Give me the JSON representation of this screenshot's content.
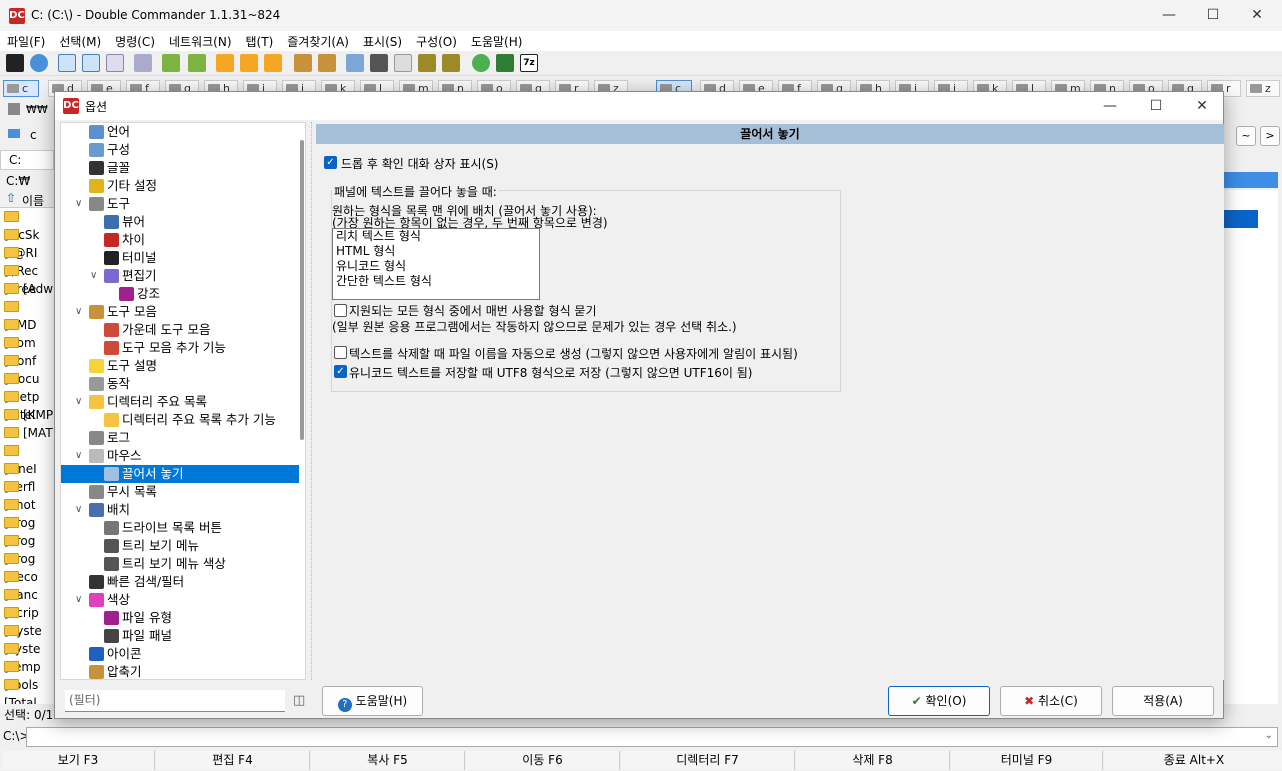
{
  "window": {
    "title": "C: (C:\\) - Double Commander 1.1.31~824",
    "logo": "DC"
  },
  "menu": [
    "파일(F)",
    "선택(M)",
    "명령(C)",
    "네트워크(N)",
    "탭(T)",
    "즐겨찾기(A)",
    "표시(S)",
    "구성(O)",
    "도움말(H)"
  ],
  "drives_left": [
    "c",
    "d",
    "e",
    "f",
    "g",
    "h",
    "i",
    "j",
    "k",
    "l",
    "m",
    "n",
    "o",
    "q",
    "r",
    "z"
  ],
  "drives_right": [
    "c",
    "d",
    "e",
    "f",
    "g",
    "h",
    "i",
    "j",
    "k",
    "l",
    "m",
    "n",
    "o",
    "q",
    "r",
    "z"
  ],
  "left_panel": {
    "drive_label": "c",
    "net_label": "₩₩",
    "path_short": "C:",
    "path": "C:₩",
    "header_name": "이름",
    "files": [
      "[!!cSk",
      "[!@RI",
      "[$Rec",
      "[.free",
      "[Adw",
      "[AMD",
      "[Aom",
      "[Conf",
      "[Docu",
      "[inetp",
      "[Intel",
      "[KMP",
      "[MAT",
      "[OneI",
      "[Perfl",
      "[Phot",
      "[Prog",
      "[Prog",
      "[Prog",
      "[Reco",
      "[Sanc",
      "[Scrip",
      "[Syste",
      "[syste",
      "[Temp",
      "[Tools",
      "[Total"
    ],
    "status": "선택: 0/1"
  },
  "cmdline": {
    "prompt": "C:\\>"
  },
  "fkeys": [
    "보기 F3",
    "편집 F4",
    "복사 F5",
    "이동 F6",
    "디렉터리 F7",
    "삭제 F8",
    "터미널 F9",
    "종료 Alt+X"
  ],
  "dialog": {
    "title": "옵션",
    "tree": [
      {
        "label": "언어",
        "level": 0
      },
      {
        "label": "구성",
        "level": 0
      },
      {
        "label": "글꼴",
        "level": 0
      },
      {
        "label": "기타 설정",
        "level": 0
      },
      {
        "label": "도구",
        "level": 0,
        "expanded": true
      },
      {
        "label": "뷰어",
        "level": 1
      },
      {
        "label": "차이",
        "level": 1
      },
      {
        "label": "터미널",
        "level": 1
      },
      {
        "label": "편집기",
        "level": 1,
        "expanded": true
      },
      {
        "label": "강조",
        "level": 2
      },
      {
        "label": "도구 모음",
        "level": 0,
        "expanded": true
      },
      {
        "label": "가운데 도구 모음",
        "level": 1
      },
      {
        "label": "도구 모음 추가 기능",
        "level": 1
      },
      {
        "label": "도구 설명",
        "level": 0
      },
      {
        "label": "동작",
        "level": 0
      },
      {
        "label": "디렉터리 주요 목록",
        "level": 0,
        "expanded": true
      },
      {
        "label": "디렉터리 주요 목록 추가 기능",
        "level": 1
      },
      {
        "label": "로그",
        "level": 0
      },
      {
        "label": "마우스",
        "level": 0,
        "expanded": true
      },
      {
        "label": "끌어서 놓기",
        "level": 1,
        "selected": true
      },
      {
        "label": "무시 목록",
        "level": 0
      },
      {
        "label": "배치",
        "level": 0,
        "expanded": true
      },
      {
        "label": "드라이브 목록 버튼",
        "level": 1
      },
      {
        "label": "트리 보기 메뉴",
        "level": 1
      },
      {
        "label": "트리 보기 메뉴 색상",
        "level": 1
      },
      {
        "label": "빠른 검색/필터",
        "level": 0
      },
      {
        "label": "색상",
        "level": 0,
        "expanded": true
      },
      {
        "label": "파일 유형",
        "level": 1
      },
      {
        "label": "파일 패널",
        "level": 1
      },
      {
        "label": "아이콘",
        "level": 0
      },
      {
        "label": "압축기",
        "level": 0
      }
    ],
    "section_title": "끌어서 놓기",
    "show_confirm": {
      "label": "드롭 후 확인 대화 상자 표시(S)",
      "checked": true
    },
    "group_title": "패널에 텍스트를 끌어다 놓을 때:",
    "order_desc_1": "원하는 형식을 목록 맨 위에 배치 (끌어서 놓기 사용):",
    "order_desc_2": "(가장 원하는 항목이 없는 경우, 두 번째 항목으로 변경)",
    "formats": [
      "리치 텍스트 형식",
      "HTML 형식",
      "유니코드 형식",
      "간단한 텍스트 형식"
    ],
    "ask_format": {
      "label": "지원되는 모든 형식 중에서 매번 사용할 형식 묻기",
      "checked": false
    },
    "ask_format_note": "(일부 원본 응용 프로그램에서는 작동하지 않으므로 문제가 있는 경우 선택 취소.)",
    "auto_name": {
      "label": "텍스트를 삭제할 때 파일 이름을 자동으로 생성 (그렇지 않으면 사용자에게 알림이 표시됨)",
      "checked": false
    },
    "utf8": {
      "label": "유니코드 텍스트를 저장할 때 UTF8 형식으로 저장 (그렇지 않으면 UTF16이 됨)",
      "checked": true
    },
    "filter_placeholder": "(필터)",
    "help_button": "도움말(H)",
    "ok_button": "확인(O)",
    "cancel_button": "취소(C)",
    "apply_button": "적용(A)"
  }
}
